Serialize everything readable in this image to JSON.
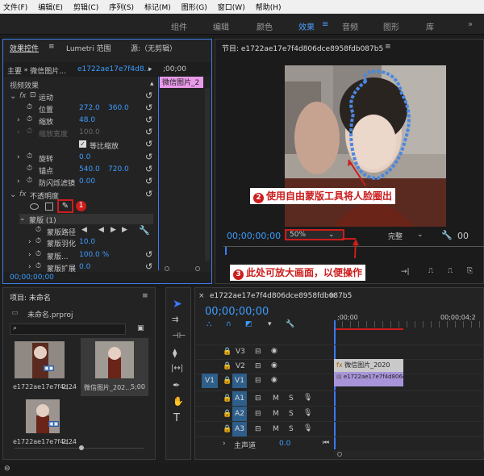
{
  "menu": [
    "文件(F)",
    "编辑(E)",
    "剪辑(C)",
    "序列(S)",
    "标记(M)",
    "图形(G)",
    "窗口(W)",
    "帮助(H)"
  ],
  "workspaces": [
    "组件",
    "编辑",
    "颜色",
    "效果",
    "音频",
    "图形",
    "库"
  ],
  "effect_controls": {
    "tab": "效果控件",
    "tab2": "Lumetri 范围",
    "tab3": "源:（无剪辑）",
    "source": "主要 * 微信图片...",
    "clip_name": "e1722ae17e7f4d8...",
    "timecode_top": ";00;00",
    "mini_clip": "微信图片_2",
    "video_effects": "视频效果",
    "motion": "运动",
    "position_label": "位置",
    "position_x": "272.0",
    "position_y": "360.0",
    "scale_label": "缩放",
    "scale_value": "48.0",
    "scale_width_label": "缩放宽度",
    "scale_width_value": "100.0",
    "uniform_scale": "等比缩放",
    "rotation_label": "旋转",
    "rotation_value": "0.0",
    "anchor_label": "锚点",
    "anchor_x": "540.0",
    "anchor_y": "720.0",
    "antiflicker_label": "防闪烁滤镜",
    "antiflicker_value": "0.00",
    "opacity": "不透明度",
    "mask": "蒙版 (1)",
    "mask_path": "蒙版路径",
    "mask_feather": "蒙版羽化",
    "mask_feather_value": "10.0",
    "mask_opacity": "蒙版...",
    "mask_opacity_value": "100.0 %",
    "mask_expand": "蒙版扩展",
    "mask_expand_value": "0.0",
    "timecode_bottom": "00;00;00;00"
  },
  "program": {
    "title": "节目: e1722ae17e7f4d806dce8958fdb087b5",
    "timecode": "00;00;00;00",
    "zoom": "50%",
    "quality": "完整",
    "right_tc": "00"
  },
  "annotations": {
    "a1_num": "1",
    "a2_num": "2",
    "a2_text": "使用自由蒙版工具将人脸圈出",
    "a3_num": "3",
    "a3_text": "此处可放大画面，以便操作"
  },
  "project": {
    "title": "项目: 未命名",
    "file": "未命名.prproj",
    "item1_name": "e1722ae17e7f4d...",
    "item1_dur": "2;24",
    "item2_name": "微信图片_202...",
    "item2_dur": "5;00",
    "item3_name": "e1722ae17e7f4d...",
    "item3_dur": "2;24"
  },
  "timeline": {
    "seq_name": "e1722ae17e7f4d806dce8958fdb087b5",
    "timecode": "00;00;00;00",
    "ruler_start": ";00;00",
    "ruler_end": "00;00;04;2",
    "tracks": [
      "V3",
      "V2",
      "V1",
      "A1",
      "A2",
      "A3"
    ],
    "source_v1": "V1",
    "master": "主声道",
    "master_value": "0.0",
    "clip_v2": "微信图片_2020",
    "clip_v1": "e1722ae17e7f4d806d"
  }
}
